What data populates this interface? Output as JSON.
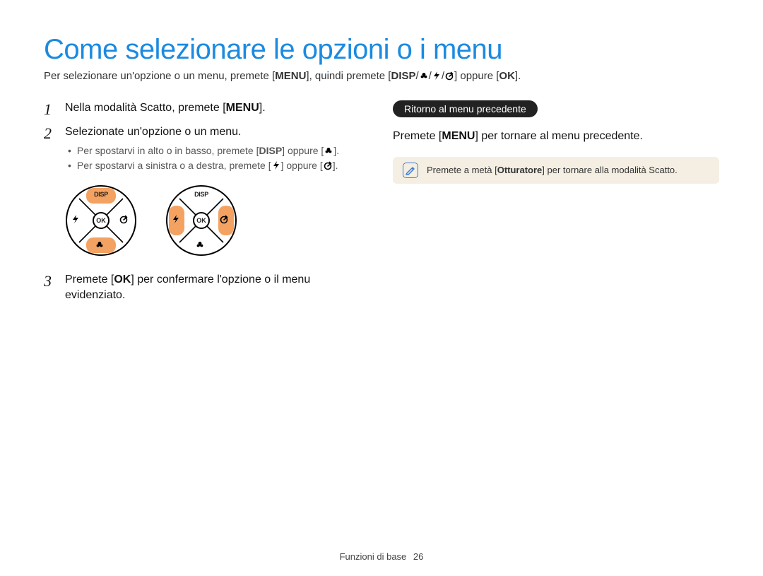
{
  "title": "Come selezionare le opzioni o i menu",
  "intro": {
    "a": "Per selezionare un'opzione o un menu, premete [",
    "menu": "MENU",
    "b": "], quindi premete [",
    "disp": "DISP",
    "c": "] oppure [",
    "ok": "OK",
    "d": "]."
  },
  "steps": {
    "s1": {
      "num": "1",
      "a": "Nella modalità Scatto, premete [",
      "menu": "MENU",
      "b": "]."
    },
    "s2": {
      "num": "2",
      "text": "Selezionate un'opzione o un menu.",
      "bul1": {
        "a": "Per spostarvi in alto o in basso, premete [",
        "disp": "DISP",
        "b": "] oppure [",
        "c": "]."
      },
      "bul2": {
        "a": "Per spostarvi a sinistra o a destra, premete [",
        "b": "] oppure [",
        "c": "]."
      }
    },
    "s3": {
      "num": "3",
      "a": "Premete [",
      "ok": "OK",
      "b": "] per confermare l'opzione o il menu evidenziato."
    }
  },
  "dial": {
    "disp": "DISP",
    "ok": "OK"
  },
  "right": {
    "pill": "Ritorno al menu precedente",
    "a": "Premete [",
    "menu": "MENU",
    "b": "] per tornare al menu precedente.",
    "note_a": "Premete a metà [",
    "note_bold": "Otturatore",
    "note_b": "] per tornare alla modalità Scatto."
  },
  "footer": {
    "section": "Funzioni di base",
    "page": "26"
  }
}
